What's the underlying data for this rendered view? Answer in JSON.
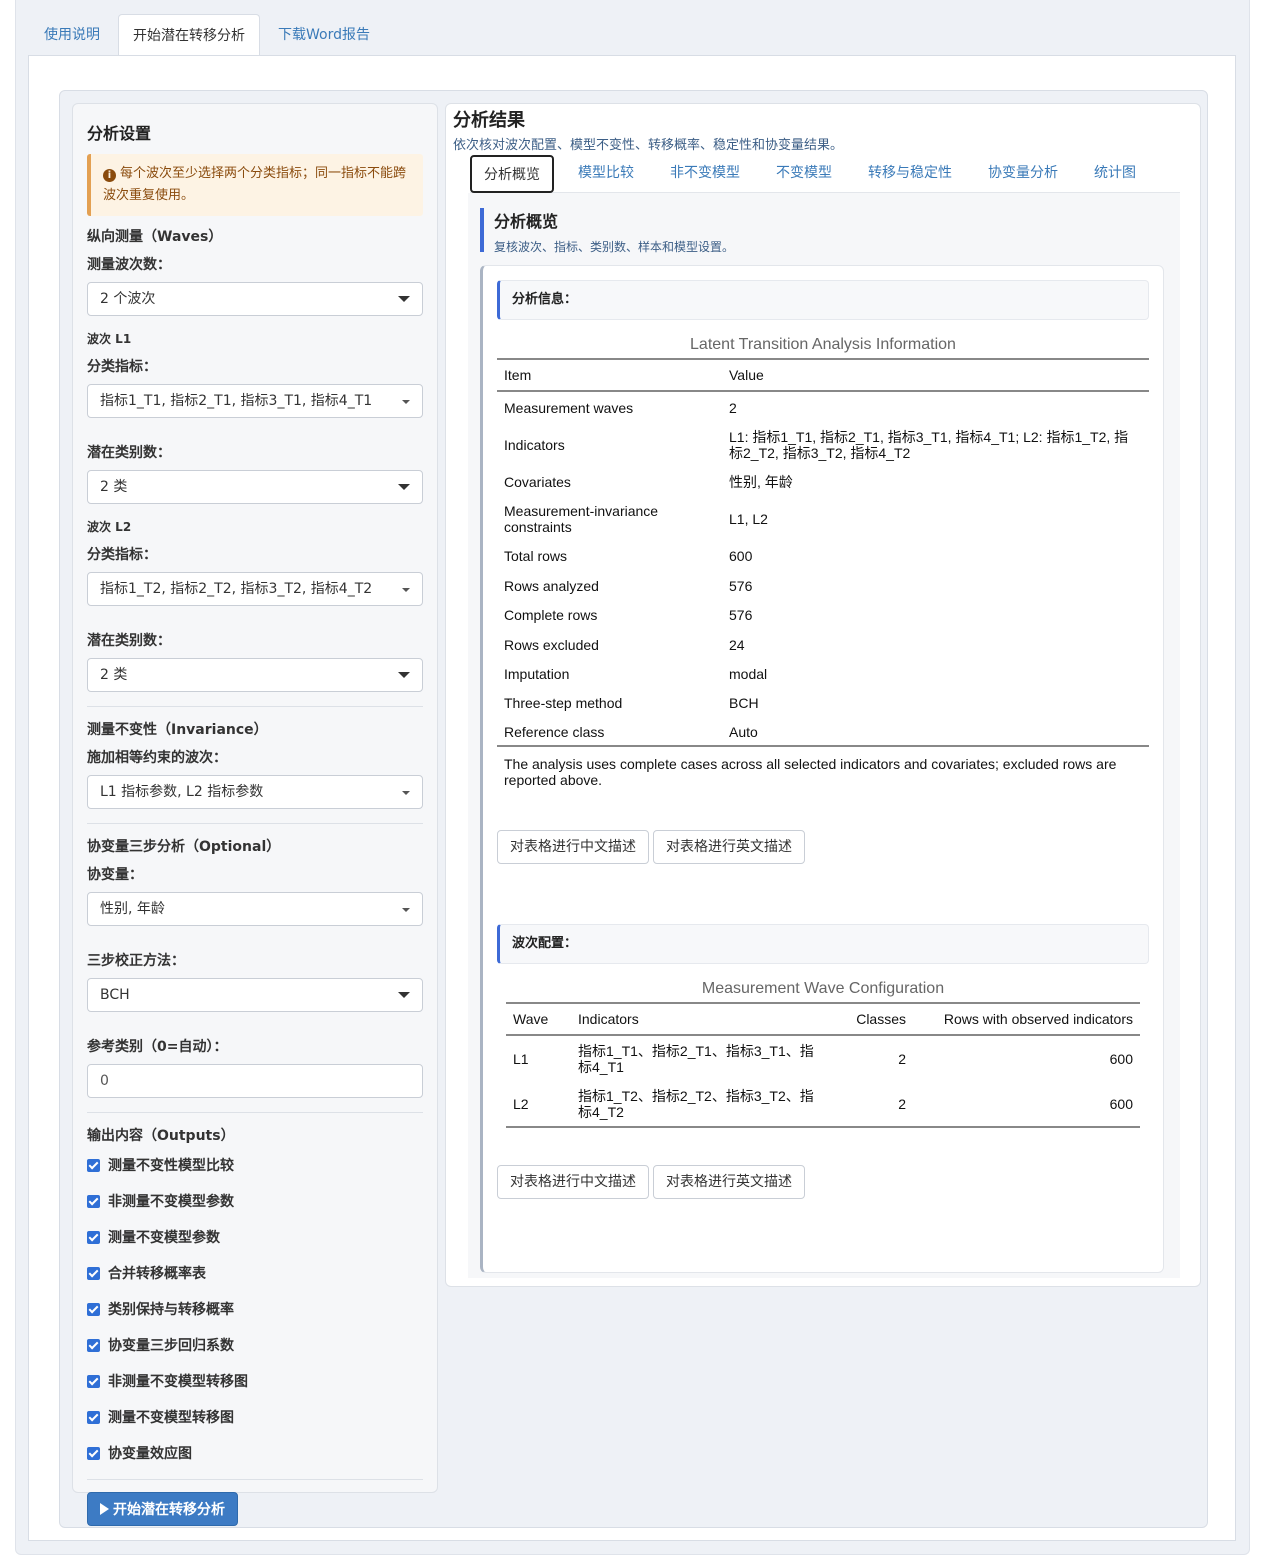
{
  "top_tabs": [
    "使用说明",
    "开始潜在转移分析",
    "下载Word报告"
  ],
  "sidebar": {
    "title": "分析设置",
    "warning": "每个波次至少选择两个分类指标；同一指标不能跨波次重复使用。",
    "waves_section": "纵向测量（Waves）",
    "wave_count_label": "测量波次数：",
    "wave_count_value": "2 个波次",
    "wave1": {
      "label": "波次 L1",
      "indicators_label": "分类指标：",
      "indicators_value": "指标1_T1, 指标2_T1, 指标3_T1, 指标4_T1",
      "classes_label": "潜在类别数：",
      "classes_value": "2 类"
    },
    "wave2": {
      "label": "波次 L2",
      "indicators_label": "分类指标：",
      "indicators_value": "指标1_T2, 指标2_T2, 指标3_T2, 指标4_T2",
      "classes_label": "潜在类别数：",
      "classes_value": "2 类"
    },
    "invariance_section": "测量不变性（Invariance）",
    "invariance_label": "施加相等约束的波次：",
    "invariance_value": "L1 指标参数, L2 指标参数",
    "covariate_section": "协变量三步分析（Optional）",
    "covariate_label": "协变量：",
    "covariate_value": "性别, 年龄",
    "method_label": "三步校正方法：",
    "method_value": "BCH",
    "ref_label": "参考类别（0=自动）：",
    "ref_value": "0",
    "outputs_section": "输出内容（Outputs）",
    "outputs": [
      "测量不变性模型比较",
      "非测量不变模型参数",
      "测量不变模型参数",
      "合并转移概率表",
      "类别保持与转移概率",
      "协变量三步回归系数",
      "非测量不变模型转移图",
      "测量不变模型转移图",
      "协变量效应图"
    ],
    "run_button": "开始潜在转移分析"
  },
  "main": {
    "title": "分析结果",
    "subtitle": "依次核对波次配置、模型不变性、转移概率、稳定性和协变量结果。",
    "tabs": [
      "分析概览",
      "模型比较",
      "非不变模型",
      "不变模型",
      "转移与稳定性",
      "协变量分析",
      "统计图"
    ],
    "overview_title": "分析概览",
    "overview_sub": "复核波次、指标、类别数、样本和模型设置。",
    "info_header": "分析信息：",
    "info_caption": "Latent Transition Analysis Information",
    "info_columns": [
      "Item",
      "Value"
    ],
    "info_rows": [
      [
        "Measurement waves",
        "2"
      ],
      [
        "Indicators",
        "L1: 指标1_T1, 指标2_T1, 指标3_T1, 指标4_T1; L2: 指标1_T2, 指标2_T2, 指标3_T2, 指标4_T2"
      ],
      [
        "Covariates",
        "性别, 年龄"
      ],
      [
        "Measurement-invariance constraints",
        "L1, L2"
      ],
      [
        "Total rows",
        "600"
      ],
      [
        "Rows analyzed",
        "576"
      ],
      [
        "Complete rows",
        "576"
      ],
      [
        "Rows excluded",
        "24"
      ],
      [
        "Imputation",
        "modal"
      ],
      [
        "Three-step method",
        "BCH"
      ],
      [
        "Reference class",
        "Auto"
      ]
    ],
    "info_note": "The analysis uses complete cases across all selected indicators and covariates; excluded rows are reported above.",
    "btn_cn": "对表格进行中文描述",
    "btn_en": "对表格进行英文描述",
    "wave_header": "波次配置：",
    "wave_caption": "Measurement Wave Configuration",
    "wave_columns": [
      "Wave",
      "Indicators",
      "Classes",
      "Rows with observed indicators"
    ],
    "wave_rows": [
      [
        "L1",
        "指标1_T1、指标2_T1、指标3_T1、指标4_T1",
        "2",
        "600"
      ],
      [
        "L2",
        "指标1_T2、指标2_T2、指标3_T2、指标4_T2",
        "2",
        "600"
      ]
    ]
  }
}
